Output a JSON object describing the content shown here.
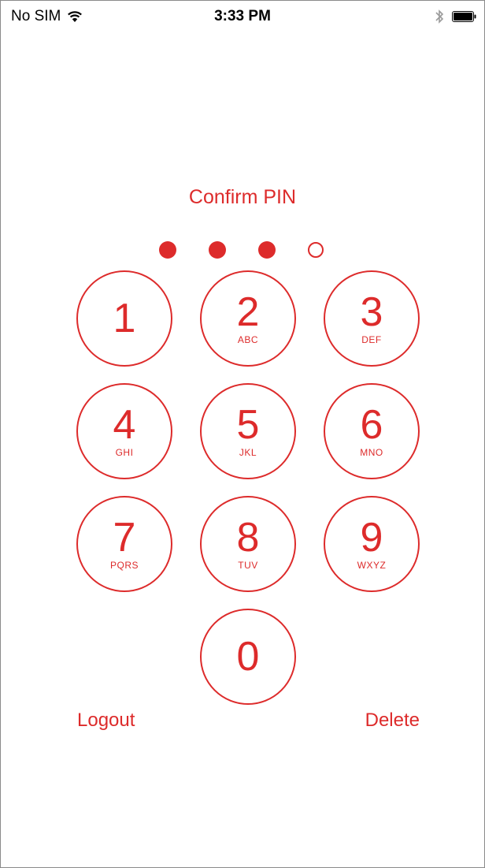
{
  "status_bar": {
    "carrier": "No SIM",
    "time": "3:33 PM",
    "wifi_icon": "wifi-icon",
    "bluetooth_icon": "bluetooth-icon",
    "battery_icon": "battery-icon"
  },
  "title": "Confirm PIN",
  "pin": {
    "length": 4,
    "entered": 3
  },
  "keys": [
    {
      "digit": "1",
      "letters": ""
    },
    {
      "digit": "2",
      "letters": "ABC"
    },
    {
      "digit": "3",
      "letters": "DEF"
    },
    {
      "digit": "4",
      "letters": "GHI"
    },
    {
      "digit": "5",
      "letters": "JKL"
    },
    {
      "digit": "6",
      "letters": "MNO"
    },
    {
      "digit": "7",
      "letters": "PQRS"
    },
    {
      "digit": "8",
      "letters": "TUV"
    },
    {
      "digit": "9",
      "letters": "WXYZ"
    },
    {
      "digit": "0",
      "letters": ""
    }
  ],
  "actions": {
    "logout_label": "Logout",
    "delete_label": "Delete"
  },
  "colors": {
    "accent": "#dd2b2b"
  }
}
